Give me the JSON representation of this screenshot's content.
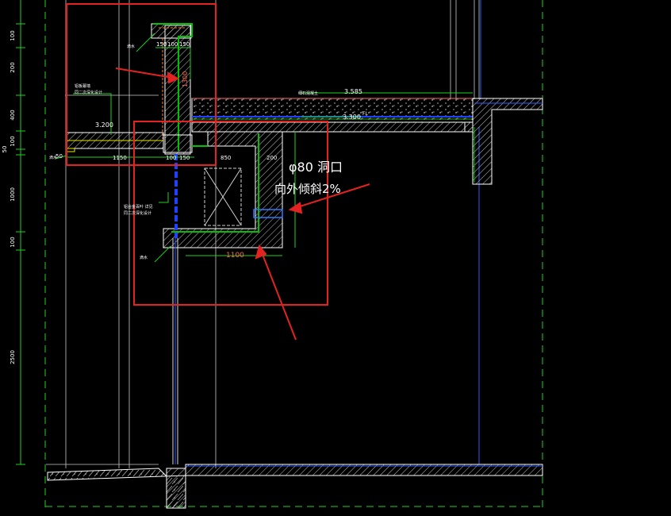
{
  "colors": {
    "background": "#000000",
    "wall_line": "#ffffff",
    "insulation": "#00c000",
    "hatch": "#bfbfbf",
    "dim_line": "#00d000",
    "dim_text": "#ffffff",
    "water_line": "#2040ff",
    "markup_red": "#e32222",
    "dash_green": "#1fd11f",
    "elev_text": "#ffffff",
    "orange": "#ff7a1a"
  },
  "left_dimensions": [
    "100",
    "200",
    "400",
    "100",
    "50",
    "1000",
    "100",
    "2500"
  ],
  "annotations": {
    "opening_text_1": "φ80 洞口",
    "opening_text_2": "向外倾斜2%",
    "dim_1100": "1100",
    "dim_150a": "150",
    "dim_100a": "100",
    "dim_150b": "150",
    "dim_1150": "1150",
    "dim_100b": "100",
    "dim_150c": "150",
    "dim_850": "850",
    "dim_200": "200",
    "dim_50": "50",
    "elev_3585": "3.585",
    "elev_3300": "3.300",
    "elev_3200": "3.200",
    "vert_1300": "1300"
  },
  "notes": {
    "left_note_1": "铝板幕墙",
    "left_note_2": "同二次深化设计",
    "mid_note_1": "铝合金百叶 详见",
    "mid_note_2": "同二次深化设计",
    "slab_note": "细石混凝土",
    "label_ding": "滴水",
    "label_tl": "滴水",
    "label_bl": "滴水",
    "fl_mark": "FL"
  }
}
